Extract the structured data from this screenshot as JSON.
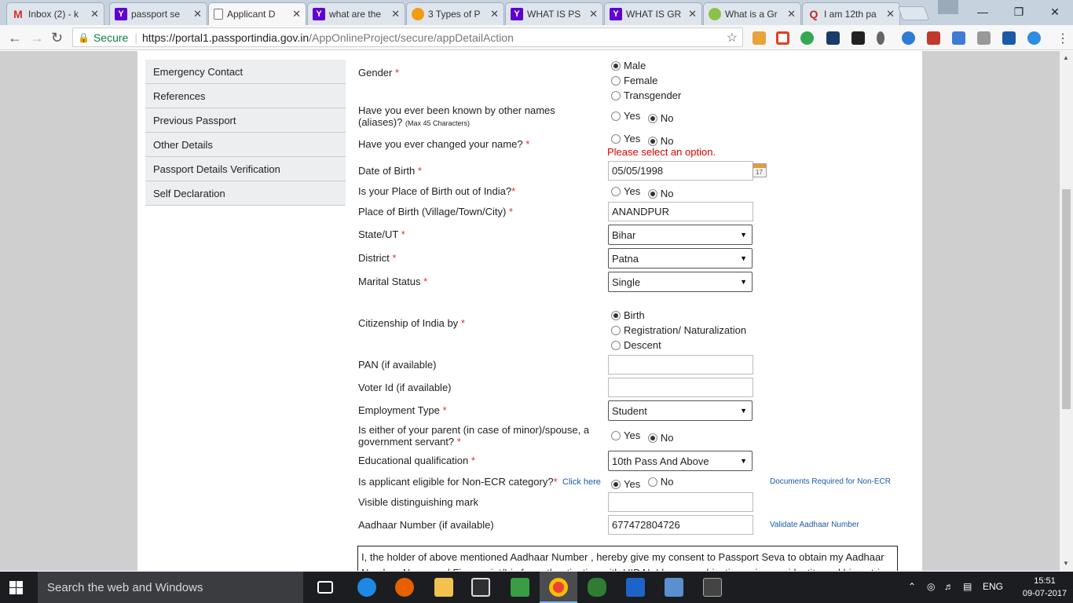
{
  "browser": {
    "tabs": [
      {
        "title": "Inbox (2) - k",
        "icon": "gmail-icon"
      },
      {
        "title": "passport se",
        "icon": "yahoo-icon"
      },
      {
        "title": "Applicant D",
        "icon": "page-icon"
      },
      {
        "title": "what are the",
        "icon": "yahoo-icon"
      },
      {
        "title": "3 Types of P",
        "icon": "orange-icon"
      },
      {
        "title": "WHAT IS PS",
        "icon": "yahoo-icon"
      },
      {
        "title": "WHAT IS GR",
        "icon": "yahoo-icon"
      },
      {
        "title": "What is a Gr",
        "icon": "green-icon"
      },
      {
        "title": "I am 12th pa",
        "icon": "quora-icon"
      }
    ],
    "close_glyph": "✕",
    "secure_label": "Secure",
    "url_host": "https://portal1.passportindia.gov.in",
    "url_path": "/AppOnlineProject/secure/appDetailAction"
  },
  "sidebar": {
    "items": [
      {
        "label": "Emergency Contact"
      },
      {
        "label": "References"
      },
      {
        "label": "Previous Passport"
      },
      {
        "label": "Other Details"
      },
      {
        "label": "Passport Details Verification"
      },
      {
        "label": "Self Declaration"
      }
    ]
  },
  "form": {
    "gender": {
      "label": "Gender",
      "options": [
        "Male",
        "Female",
        "Transgender"
      ],
      "selected": "Male"
    },
    "aliases": {
      "label_line1": "Have you ever been known by other names",
      "label_line2": "(aliases)?",
      "hint": "(Max 45 Characters)",
      "yes": "Yes",
      "no": "No",
      "selected": "No"
    },
    "changed_name": {
      "label": "Have you ever changed your name?",
      "yes": "Yes",
      "no": "No",
      "selected": "No",
      "error": "Please select an option."
    },
    "dob": {
      "label": "Date of Birth",
      "value": "05/05/1998",
      "calendar_day": "17"
    },
    "pob_out": {
      "label": "Is your Place of Birth out of India?",
      "yes": "Yes",
      "no": "No",
      "selected": "No"
    },
    "pob": {
      "label": "Place of Birth (Village/Town/City)",
      "value": "ANANDPUR"
    },
    "state": {
      "label": "State/UT",
      "value": "Bihar"
    },
    "district": {
      "label": "District",
      "value": "Patna"
    },
    "marital": {
      "label": "Marital Status",
      "value": "Single"
    },
    "citizenship": {
      "label": "Citizenship of India by",
      "options": [
        "Birth",
        "Registration/ Naturalization",
        "Descent"
      ],
      "selected": "Birth"
    },
    "pan": {
      "label": "PAN (if available)",
      "value": ""
    },
    "voter": {
      "label": "Voter Id (if available)",
      "value": ""
    },
    "employment": {
      "label": "Employment Type",
      "value": "Student"
    },
    "govt_servant": {
      "label_line1": "Is either of your parent (in case of minor)/spouse, a",
      "label_line2": "government servant?",
      "yes": "Yes",
      "no": "No",
      "selected": "No"
    },
    "education": {
      "label": "Educational qualification",
      "value": "10th Pass And Above"
    },
    "non_ecr": {
      "label": "Is applicant eligible for Non-ECR category?",
      "click_here": "Click here",
      "yes": "Yes",
      "no": "No",
      "selected": "Yes",
      "docs_link": "Documents Required for Non-ECR"
    },
    "mark": {
      "label": "Visible distinguishing mark",
      "value": ""
    },
    "aadhaar": {
      "label": "Aadhaar Number (if available)",
      "value": "677472804726",
      "validate_link": "Validate Aadhaar Number"
    },
    "consent_text": "I, the holder of above mentioned Aadhaar Number , hereby give my consent to Passport Seva to obtain my Aadhaar Number, Name and Fingerprint/Iris for authentication with UIDAI. I have no objection using my identity and biometric"
  },
  "taskbar": {
    "search_placeholder": "Search the web and Windows",
    "language": "ENG",
    "time": "15:51",
    "date": "09-07-2017"
  }
}
